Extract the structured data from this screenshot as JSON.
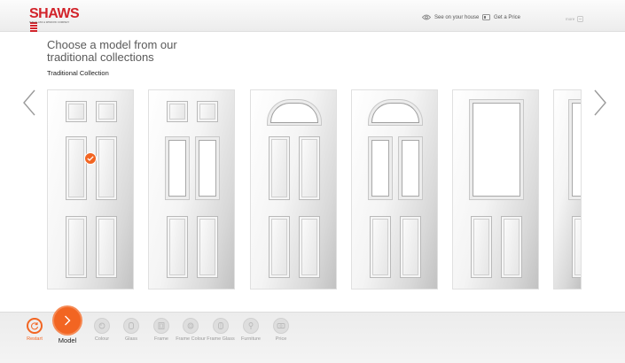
{
  "brand": {
    "logo_text": "SHAWS",
    "tagline": "THE GLASS & WINDOW COMPANY",
    "accent_color": "#d2232a"
  },
  "header": {
    "see_on_house": "See on your house",
    "get_price": "Get a Price",
    "more": "more"
  },
  "main": {
    "title": "Choose a model from our traditional collections",
    "collection": "Traditional Collection",
    "selected_index": 0
  },
  "doors": [
    {
      "style": "6-panel",
      "selected": true
    },
    {
      "style": "4-panel-2-glass",
      "selected": false
    },
    {
      "style": "fanlight-4-panel",
      "selected": false
    },
    {
      "style": "fanlight-2-glass",
      "selected": false
    },
    {
      "style": "large-glass-2-panel",
      "selected": false
    },
    {
      "style": "partial",
      "selected": false
    }
  ],
  "footer": {
    "accent_color": "#f26522",
    "steps": [
      {
        "label": "Restart",
        "icon": "restart-icon"
      },
      {
        "label": "Model",
        "icon": "chevron-right-icon"
      },
      {
        "label": "Colour",
        "icon": "colour-icon"
      },
      {
        "label": "Glass",
        "icon": "glass-icon"
      },
      {
        "label": "Frame",
        "icon": "frame-icon"
      },
      {
        "label": "Frame Colour",
        "icon": "frame-colour-icon"
      },
      {
        "label": "Frame Glass",
        "icon": "frame-glass-icon"
      },
      {
        "label": "Furniture",
        "icon": "furniture-icon"
      },
      {
        "label": "Price",
        "icon": "price-icon"
      }
    ]
  }
}
